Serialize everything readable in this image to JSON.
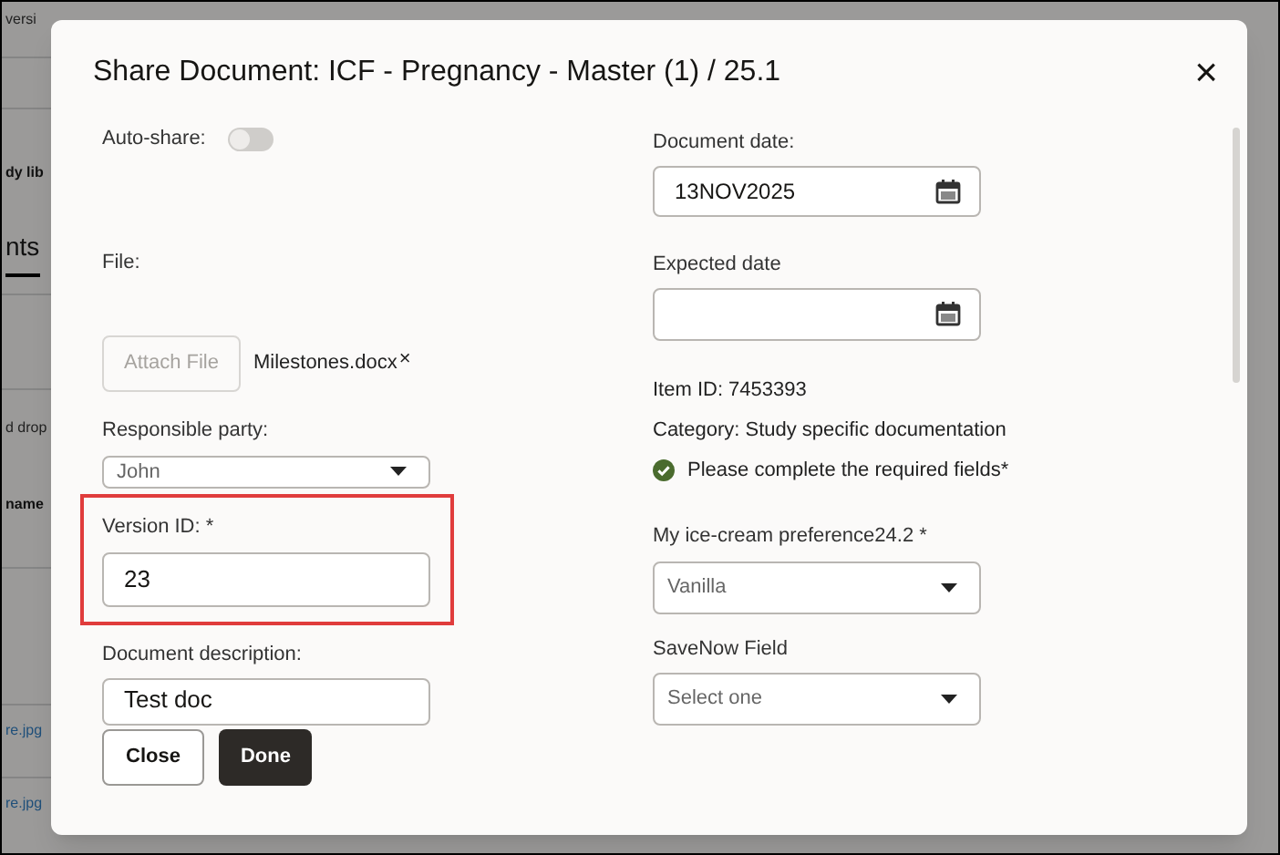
{
  "background_page": {
    "items": [
      {
        "text": "versi",
        "kind": "text"
      },
      {
        "text": "dy lib",
        "kind": "heading"
      },
      {
        "text": "nts",
        "kind": "tab"
      },
      {
        "text": "d drop",
        "kind": "text"
      },
      {
        "text": "name",
        "kind": "heading"
      },
      {
        "text": "re.jpg",
        "kind": "link"
      },
      {
        "text": "re.jpg",
        "kind": "link"
      }
    ]
  },
  "dialog": {
    "title": "Share Document: ICF - Pregnancy - Master (1) / 25.1",
    "close_icon": "×",
    "left_column": {
      "auto_share": {
        "label": "Auto-share:",
        "on": false
      },
      "file": {
        "label": "File:",
        "attach_button": "Attach File",
        "attach_disabled": true,
        "file_name": "Milestones.docx",
        "remove_icon": "×"
      },
      "responsible_party": {
        "label": "Responsible party:",
        "value": "John"
      },
      "version_id": {
        "label": "Version ID: *",
        "value": "23",
        "highlighted": true
      },
      "document_description": {
        "label": "Document description:",
        "value": "Test doc"
      }
    },
    "right_column": {
      "document_date": {
        "label": "Document date:",
        "value": "13NOV2025"
      },
      "expected_date": {
        "label": "Expected date"
      },
      "item_id": "Item ID: 7453393",
      "category": "Category: Study specific documentation",
      "status": {
        "text": "Please complete the required fields*",
        "complete": true
      },
      "ice_cream": {
        "label": "My ice-cream preference24.2 *",
        "value": "Vanilla"
      },
      "savenow": {
        "label": "SaveNow Field",
        "placeholder": "Select one"
      }
    },
    "buttons": [
      {
        "label": "Close",
        "kind": "secondary"
      },
      {
        "label": "Done",
        "kind": "primary"
      }
    ]
  }
}
